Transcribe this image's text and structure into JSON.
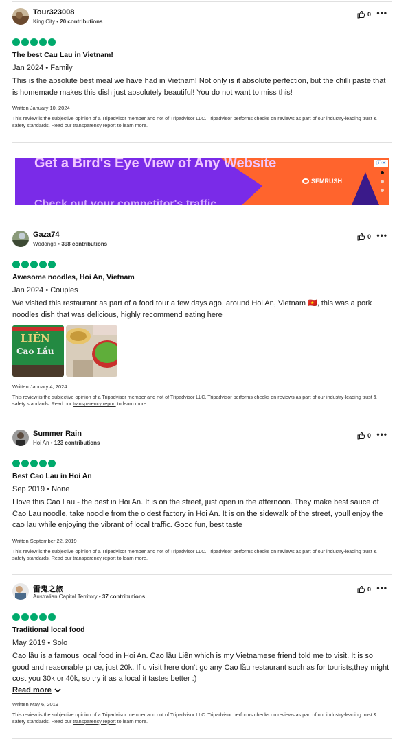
{
  "ad": {
    "headline": "Get a Bird's Eye View of Any Website",
    "brand": "SEMRUSH",
    "subline": "Check out your competitor's traffic"
  },
  "reviews": [
    {
      "user": "Tour323008",
      "location": "King City",
      "contributions": "20 contributions",
      "helpful_count": "0",
      "title": "The best Cau Lau in Vietnam!",
      "date_trip": "Jan 2024 • Family",
      "body": "This is the absolute best meal we have had in Vietnam! Not only is it absolute perfection, but the chilli paste that is homemade makes this dish just absolutely beautiful! You do not want to miss this!",
      "written": "Written January 10, 2024"
    },
    {
      "user": "Gaza74",
      "location": "Wodonga",
      "contributions": "398 contributions",
      "helpful_count": "0",
      "title": "Awesome noodles, Hoi An, Vietnam",
      "date_trip": "Jan 2024 • Couples",
      "body": "We visited this restaurant as part of a food tour a few days ago, around Hoi An, Vietnam 🇻🇳, this was a pork noodles dish that was delicious, highly recommend eating here",
      "photo_sign_1": "LIÊN",
      "photo_sign_2": "Cao Lầu",
      "written": "Written January 4, 2024"
    },
    {
      "user": "Summer Rain",
      "location": "Hoi An",
      "contributions": "123 contributions",
      "helpful_count": "0",
      "title": "Best Cao Lau in Hoi An",
      "date_trip": "Sep 2019 • None",
      "body": "I love this Cao Lau - the best in Hoi An. It is on the street, just open in the afternoon. They make best sauce of Cao Lau noodle, take noodle from the oldest factory in Hoi An. It is on the sidewalk of the street, youll enjoy the cao lau while enjoying the vibrant of local traffic. Good fun, best taste",
      "written": "Written September 22, 2019"
    },
    {
      "user": "雷鬼之旅",
      "location": "Australian Capital Territory",
      "contributions": "37 contributions",
      "helpful_count": "0",
      "title": "Traditional local food",
      "date_trip": "May 2019 • Solo",
      "body": "Cao lầu is a famous local food in Hoi An. Cao lầu Liên which is my Vietnamese friend told me to visit. It is so good and reasonable price, just 20k. If u visit here don't go any Cao lầu restaurant such as for tourists,they might cost you 30k or 40k, so try it as a local it tastes better :)",
      "read_more": "Read more",
      "written": "Written May 6, 2019"
    }
  ],
  "disclaimer_pre": "This review is the subjective opinion of a Tripadvisor member and not of Tripadvisor LLC. Tripadvisor performs checks on reviews as part of our industry-leading trust & safety standards. Read our ",
  "disclaimer_link": "transparency report",
  "disclaimer_post": " to learn more.",
  "colors": {
    "bubble": "#00aa6c",
    "ad_purple": "#7a2be8",
    "ad_orange": "#ff642d"
  }
}
